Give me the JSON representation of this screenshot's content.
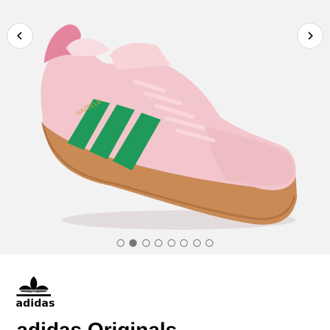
{
  "gallery": {
    "image": "product-photo-pink-gazelle-sneaker",
    "prev_icon": "chevron-left-icon",
    "next_icon": "chevron-right-icon",
    "shoe_stripe_text": "GAZELLE",
    "slide_count": 8,
    "active_slide": 2
  },
  "brand": {
    "logo_icon": "adidas-trefoil-logo",
    "wordmark": "adidas"
  },
  "product": {
    "title": "adidas Originals"
  },
  "colors": {
    "upper": "#f2c6cc",
    "stripes": "#1f9a5a",
    "sole": "#c98a55",
    "gallery_bg": "#f3f2f2"
  }
}
